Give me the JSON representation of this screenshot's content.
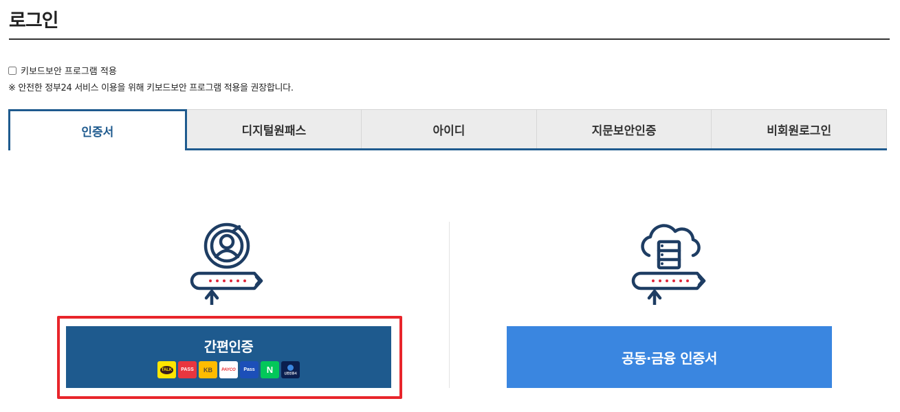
{
  "page": {
    "title": "로그인"
  },
  "keyboard_security": {
    "checkbox_label": "키보드보안 프로그램 적용",
    "checked": false,
    "note": "※ 안전한 정부24 서비스 이용을 위해 키보드보안 프로그램 적용을 권장합니다."
  },
  "tabs": [
    {
      "label": "인증서",
      "active": true
    },
    {
      "label": "디지털원패스",
      "active": false
    },
    {
      "label": "아이디",
      "active": false
    },
    {
      "label": "지문보안인증",
      "active": false
    },
    {
      "label": "비회원로그인",
      "active": false
    }
  ],
  "login_options": {
    "simple_auth": {
      "label": "간편인증",
      "icon": "user-password-icon",
      "providers": [
        {
          "name": "kakao-icon",
          "text": "TALK"
        },
        {
          "name": "pass-icon",
          "text": "PASS"
        },
        {
          "name": "kb-icon",
          "text": "KB"
        },
        {
          "name": "payco-icon",
          "text": "PAYCO"
        },
        {
          "name": "samsung-pass-icon",
          "text": "Pass"
        },
        {
          "name": "naver-icon",
          "text": "N"
        },
        {
          "name": "shinhan-icon",
          "text": "신한인증서"
        }
      ]
    },
    "joint_cert": {
      "label": "공동·금융 인증서",
      "icon": "cloud-server-password-icon"
    }
  },
  "colors": {
    "primary": "#1e5a8e",
    "cert_button": "#3a86e0",
    "highlight": "#e8252b",
    "password_dots": "#e0263a"
  }
}
